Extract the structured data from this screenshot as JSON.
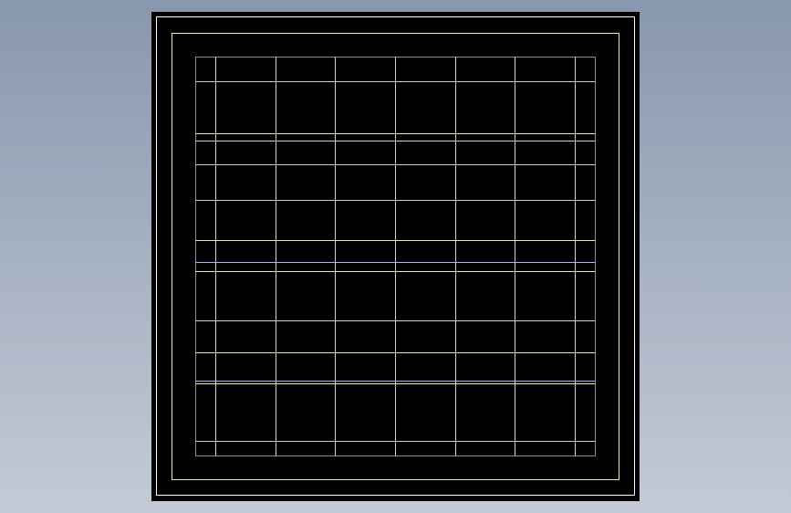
{
  "viewport": {
    "background_top": "#8797ae",
    "background_bottom": "#c4c9d6"
  },
  "drawing": {
    "sheet_color": "#000000",
    "outer_border_color": "#ffffff",
    "inner_border_color": "#e8eca0",
    "grid_frame_color": "#8c8c8c",
    "grid_white_color": "#d2d2d2",
    "grid_yellow_color": "#e8eca0",
    "grid_blue_color": "#b4b4ff",
    "column_count": 8,
    "row_line_count": 12
  }
}
